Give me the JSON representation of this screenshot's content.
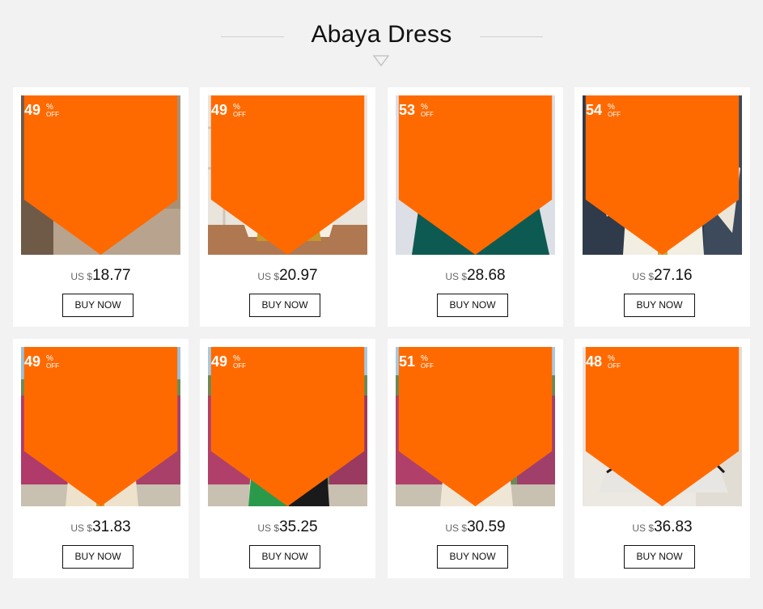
{
  "section": {
    "title": "Abaya Dress"
  },
  "colors": {
    "badge": "#ff6a00",
    "background": "#f2f2f2"
  },
  "products": [
    {
      "discount": "49",
      "percent_symbol": "%",
      "off_label": "OFF",
      "currency": "US $",
      "price": "18.77",
      "button": "BUY NOW"
    },
    {
      "discount": "49",
      "percent_symbol": "%",
      "off_label": "OFF",
      "currency": "US $",
      "price": "20.97",
      "button": "BUY NOW"
    },
    {
      "discount": "53",
      "percent_symbol": "%",
      "off_label": "OFF",
      "currency": "US $",
      "price": "28.68",
      "button": "BUY NOW"
    },
    {
      "discount": "54",
      "percent_symbol": "%",
      "off_label": "OFF",
      "currency": "US $",
      "price": "27.16",
      "button": "BUY NOW"
    },
    {
      "discount": "49",
      "percent_symbol": "%",
      "off_label": "OFF",
      "currency": "US $",
      "price": "31.83",
      "button": "BUY NOW"
    },
    {
      "discount": "49",
      "percent_symbol": "%",
      "off_label": "OFF",
      "currency": "US $",
      "price": "35.25",
      "button": "BUY NOW"
    },
    {
      "discount": "51",
      "percent_symbol": "%",
      "off_label": "OFF",
      "currency": "US $",
      "price": "30.59",
      "button": "BUY NOW"
    },
    {
      "discount": "48",
      "percent_symbol": "%",
      "off_label": "OFF",
      "currency": "US $",
      "price": "36.83",
      "button": "BUY NOW"
    }
  ]
}
